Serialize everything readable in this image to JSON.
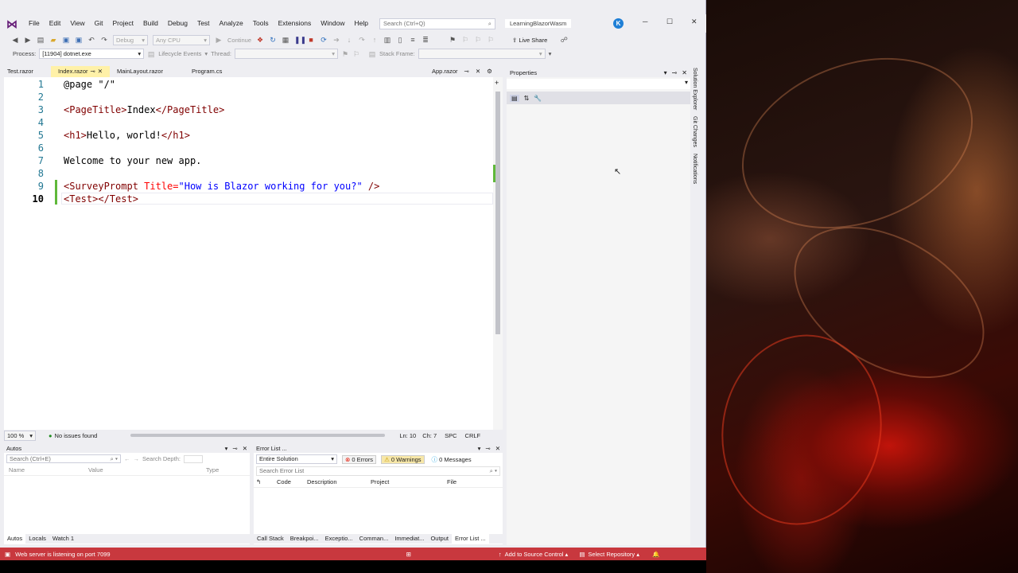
{
  "window": {
    "project_name": "LearningBlazorWasm",
    "account_initial": "K",
    "search_placeholder": "Search (Ctrl+Q)"
  },
  "menu": [
    "File",
    "Edit",
    "View",
    "Git",
    "Project",
    "Build",
    "Debug",
    "Test",
    "Analyze",
    "Tools",
    "Extensions",
    "Window",
    "Help"
  ],
  "toolbar": {
    "config": "Debug",
    "platform": "Any CPU",
    "continue_label": "Continue",
    "live_share": "Live Share",
    "process_label": "Process:",
    "process_value": "[11904] dotnet.exe",
    "lifecycle_label": "Lifecycle Events",
    "thread_label": "Thread:",
    "stack_frame_label": "Stack Frame:"
  },
  "doc_tabs": [
    {
      "label": "Test.razor",
      "active": false
    },
    {
      "label": "Index.razor",
      "active": true
    },
    {
      "label": "MainLayout.razor",
      "active": false
    },
    {
      "label": "Program.cs",
      "active": false
    },
    {
      "label": "App.razor",
      "active": false
    }
  ],
  "editor": {
    "line_numbers": [
      "1",
      "2",
      "3",
      "4",
      "5",
      "6",
      "7",
      "8",
      "9",
      "10"
    ],
    "current_line": "10",
    "lines": {
      "l1": "@page \"/\"",
      "l3_open": "<PageTitle>",
      "l3_text": "Index",
      "l3_close": "</PageTitle>",
      "l5_open": "<h1>",
      "l5_text": "Hello, world!",
      "l5_close": "</h1>",
      "l7": "Welcome to your new app.",
      "l9_tag": "<SurveyPrompt",
      "l9_attr": " Title=",
      "l9_str": "\"How is Blazor working for you?\"",
      "l9_end": " />",
      "l10_open": "<Test>",
      "l10_close": "</Test>"
    },
    "zoom": "100 %",
    "issues": "No issues found",
    "ln": "Ln: 10",
    "ch": "Ch: 7",
    "spc": "SPC",
    "crlf": "CRLF"
  },
  "properties": {
    "title": "Properties"
  },
  "side_tabs": [
    "Solution Explorer",
    "Git Changes",
    "Notifications"
  ],
  "autos": {
    "title": "Autos",
    "search_placeholder": "Search (Ctrl+E)",
    "search_depth": "Search Depth:",
    "columns": [
      "Name",
      "Value",
      "Type"
    ],
    "tabs": [
      "Autos",
      "Locals",
      "Watch 1"
    ]
  },
  "error_list": {
    "title": "Error List ...",
    "scope": "Entire Solution",
    "errors": "0 Errors",
    "warnings": "0 Warnings",
    "messages": "0 Messages",
    "search_placeholder": "Search Error List",
    "columns": [
      "Code",
      "Description",
      "Project",
      "File"
    ],
    "tabs": [
      "Call Stack",
      "Breakpoi...",
      "Exceptio...",
      "Comman...",
      "Immediat...",
      "Output",
      "Error List ..."
    ]
  },
  "statusbar": {
    "message": "Web server is listening on port 7099",
    "source_control": "Add to Source Control",
    "repository": "Select Repository"
  },
  "colors": {
    "accent": "#68217a",
    "status_bar": "#c8383e",
    "active_tab": "#fff1a8",
    "error_red": "#e51400",
    "warning_yellow": "#ffcc00",
    "info_blue": "#1ba1e2"
  }
}
